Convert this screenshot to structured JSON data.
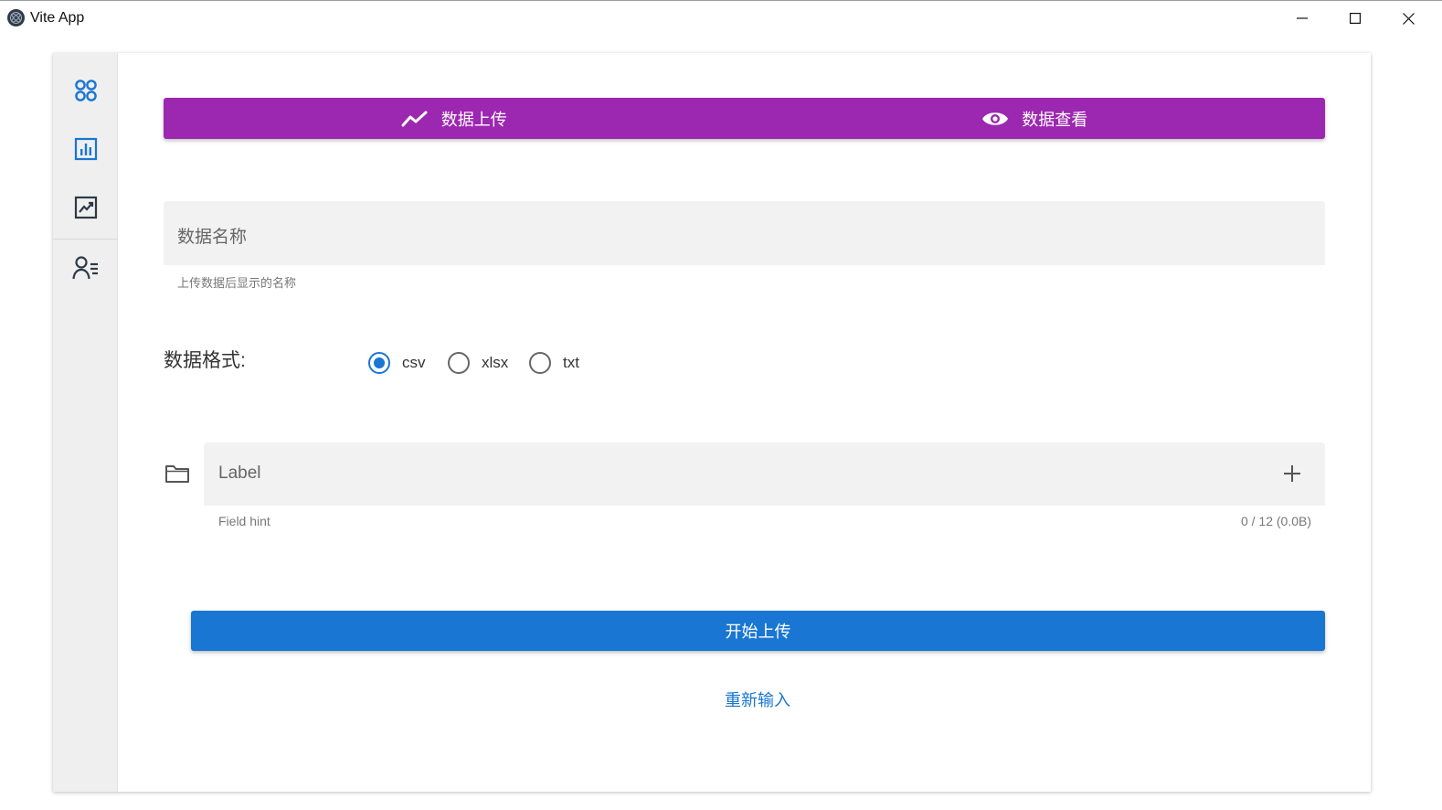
{
  "window": {
    "title": "Vite App"
  },
  "rail": {
    "items": [
      {
        "icon": "apps-grid-icon"
      },
      {
        "icon": "bar-chart-icon"
      },
      {
        "icon": "trending-chart-icon"
      },
      {
        "icon": "user-list-icon"
      }
    ]
  },
  "tabs": [
    {
      "label": "数据上传",
      "icon": "trending-up-icon"
    },
    {
      "label": "数据查看",
      "icon": "eye-icon"
    }
  ],
  "form": {
    "name_field": {
      "label": "数据名称",
      "hint": "上传数据后显示的名称"
    },
    "format": {
      "label": "数据格式:",
      "options": [
        "csv",
        "xlsx",
        "txt"
      ],
      "selected": "csv"
    },
    "file_field": {
      "label": "Label",
      "hint": "Field hint",
      "counter": "0 / 12 (0.0B)"
    },
    "submit_label": "开始上传",
    "reset_label": "重新输入"
  },
  "colors": {
    "tabs_bg": "#9c27b0",
    "primary": "#1976d2",
    "rail_bg": "#efefef"
  }
}
